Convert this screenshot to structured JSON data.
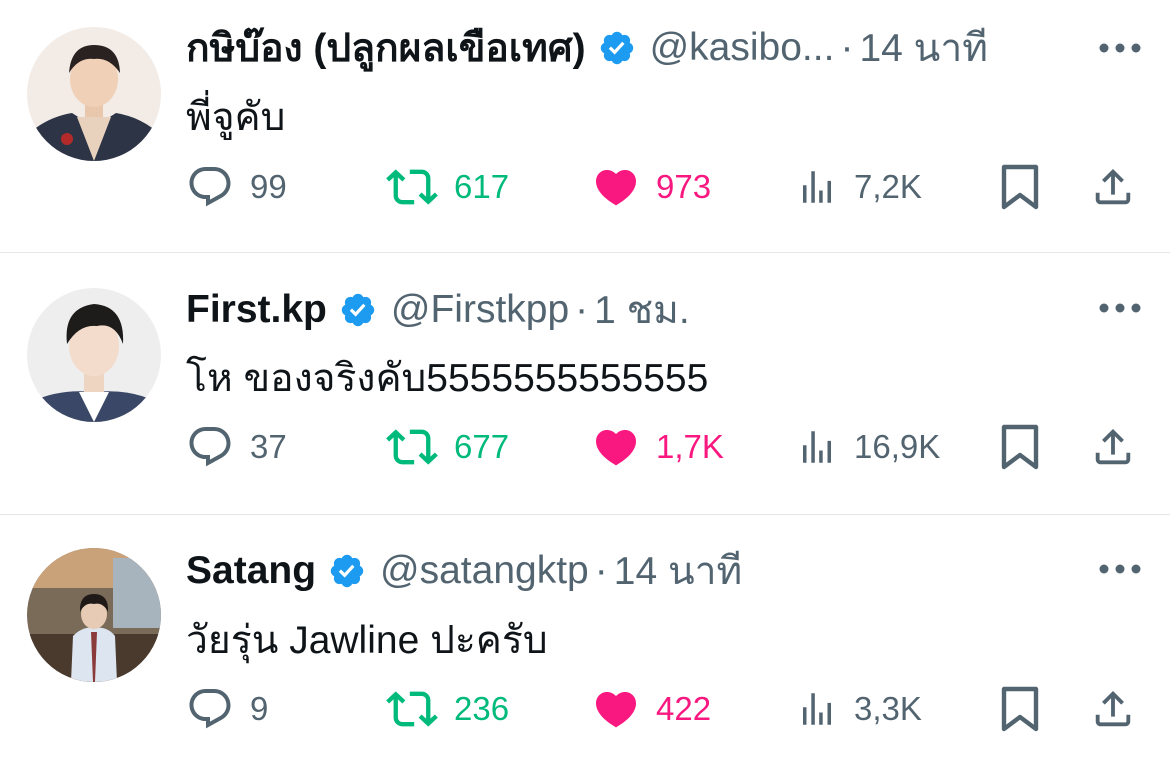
{
  "tweets": [
    {
      "author_name": "กษิบ๊อง (ปลูกผลเขือเทศ)",
      "handle": "@kasibo...",
      "separator": "·",
      "time": "14 นาที",
      "text": "พี่จูคับ",
      "replies": "99",
      "retweets": "617",
      "likes": "973",
      "views": "7,2K",
      "verified": true
    },
    {
      "author_name": "First.kp",
      "handle": "@Firstkpp",
      "separator": "·",
      "time": "1 ชม.",
      "text": "โห ของจริงคับ5555555555555",
      "replies": "37",
      "retweets": "677",
      "likes": "1,7K",
      "views": "16,9K",
      "verified": true
    },
    {
      "author_name": "Satang",
      "handle": "@satangktp",
      "separator": "·",
      "time": "14 นาที",
      "text": "วัยรุ่น Jawline ปะครับ",
      "replies": "9",
      "retweets": "236",
      "likes": "422",
      "views": "3,3K",
      "verified": true
    }
  ],
  "icons": {
    "reply": "reply-icon",
    "retweet": "retweet-icon",
    "like": "heart-icon",
    "views": "views-icon",
    "bookmark": "bookmark-icon",
    "share": "share-icon",
    "verified": "verified-badge-icon",
    "more": "more-icon"
  },
  "colors": {
    "text": "#0f1419",
    "secondary": "#536471",
    "retweet": "#00ba7c",
    "like": "#f91880",
    "verified": "#1d9bf0",
    "divider": "#e5e8eb"
  }
}
